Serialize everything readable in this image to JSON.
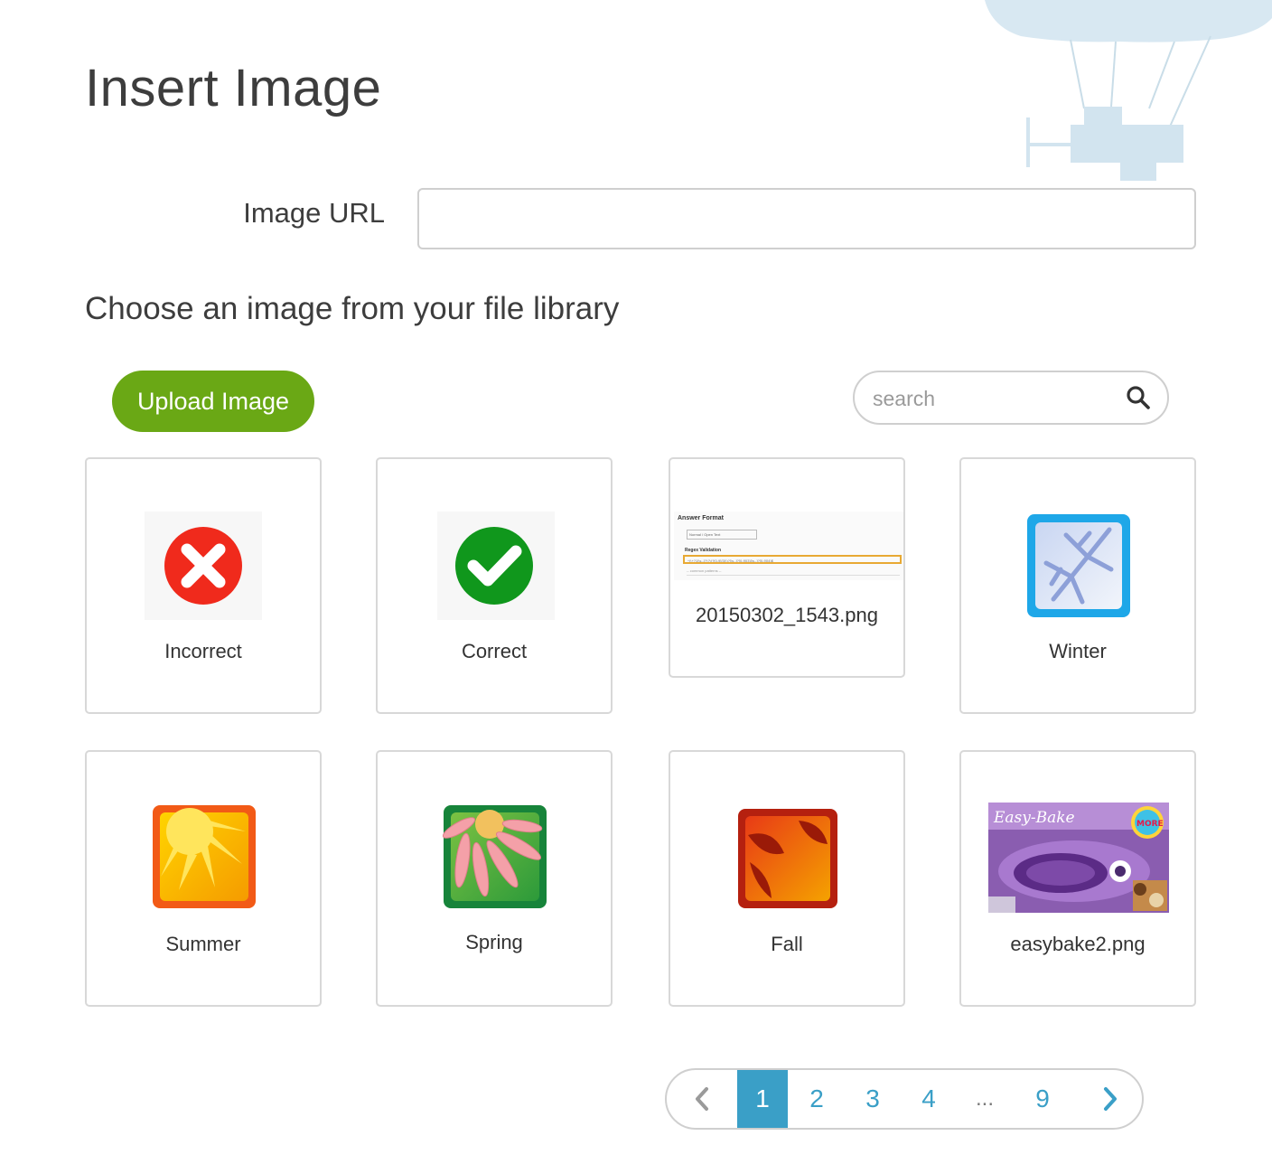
{
  "page": {
    "title": "Insert Image"
  },
  "image_url": {
    "label": "Image URL",
    "value": "",
    "placeholder": ""
  },
  "library": {
    "heading": "Choose an image from your file library",
    "upload_label": "Upload Image",
    "search_placeholder": "search"
  },
  "images": [
    {
      "label": "Incorrect",
      "icon": "x-circle-icon",
      "color": "#f02a1c"
    },
    {
      "label": "Correct",
      "icon": "checkmark-circle-icon",
      "color": "#10971c"
    },
    {
      "label": "20150302_1543.png",
      "icon": "screenshot-thumbnail"
    },
    {
      "label": "Winter",
      "icon": "snowflake-icon",
      "color": "#1ea7e8"
    },
    {
      "label": "Summer",
      "icon": "sun-icon",
      "color": "#f25a16"
    },
    {
      "label": "Spring",
      "icon": "flower-icon",
      "color": "#17843a"
    },
    {
      "label": "Fall",
      "icon": "leaves-icon",
      "color": "#b5200f"
    },
    {
      "label": "easybake2.png",
      "icon": "easy-bake-oven-photo"
    }
  ],
  "screenshot_thumb": {
    "heading": "Answer Format",
    "select_value": "Normal / Open Text",
    "validation_label": "Regex Validation",
    "regex_value": "^(\\+?1[\\s.-]?)?\\(?[0-9]{3}\\)?[\\s.-]?[0-9]{3}[\\s.-]?[0-9]{4}$",
    "patterns_value": "-- common patterns --"
  },
  "easybake_thumb": {
    "brand": "Easy-Bake",
    "badge": "MORE"
  },
  "pagination": {
    "pages": [
      "1",
      "2",
      "3",
      "4",
      "...",
      "9"
    ],
    "current": "1"
  },
  "colors": {
    "accent_blue": "#3a9fc7",
    "upload_green": "#6aa815",
    "border_gray": "#cfcfcf"
  }
}
